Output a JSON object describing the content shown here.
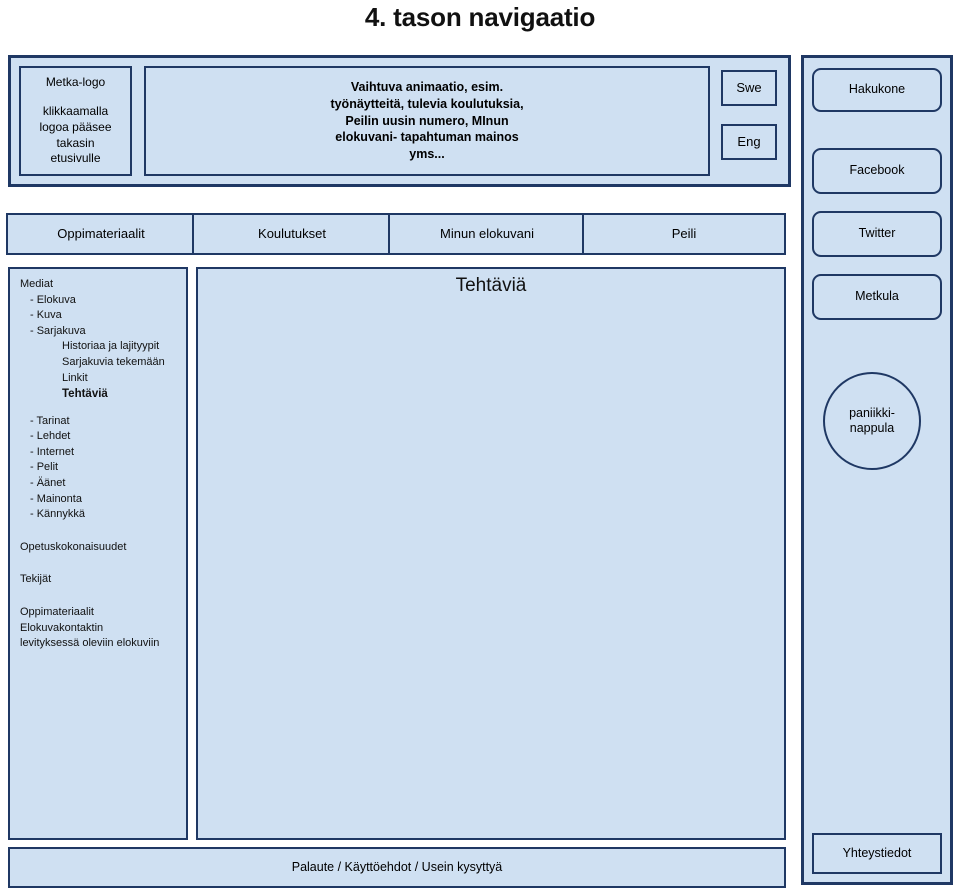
{
  "page": {
    "title": "4. tason navigaatio"
  },
  "colors": {
    "fill": "#cfe0f2",
    "border": "#1f3864",
    "text": "#111111",
    "background": "#ffffff"
  },
  "header": {
    "logo": {
      "title": "Metka-logo",
      "subtitle": "klikkaamalla\nlogoa pääsee\ntakasin\netusivulle",
      "subtitle_lines": [
        "klikkaamalla",
        "logoa pääsee",
        "takasin",
        "etusivulle"
      ]
    },
    "animation": {
      "lines": [
        "Vaihtuva animaatio, esim.",
        "työnäytteitä, tulevia koulutuksia,",
        "Peilin uusin numero, MInun",
        "elokuvani- tapahtuman mainos",
        "yms..."
      ]
    },
    "languages": [
      {
        "label": "Swe"
      },
      {
        "label": "Eng"
      }
    ]
  },
  "nav": {
    "tabs": [
      {
        "label": "Oppimateriaalit"
      },
      {
        "label": "Koulutukset"
      },
      {
        "label": "Minun elokuvani"
      },
      {
        "label": "Peili"
      }
    ]
  },
  "side_menu": {
    "items": [
      {
        "label": "Mediat",
        "level": 1
      },
      {
        "label": "- Elokuva",
        "level": 2
      },
      {
        "label": "- Kuva",
        "level": 2
      },
      {
        "label": "- Sarjakuva",
        "level": 2
      },
      {
        "label": "Historiaa ja lajityypit",
        "level": 3
      },
      {
        "label": "Sarjakuvia tekemään",
        "level": 3
      },
      {
        "label": "Linkit",
        "level": 3
      },
      {
        "label": "Tehtäviä",
        "level": 3,
        "active": true
      },
      {
        "label": "- Tarinat",
        "level": 2
      },
      {
        "label": "- Lehdet",
        "level": 2
      },
      {
        "label": "- Internet",
        "level": 2
      },
      {
        "label": "- Pelit",
        "level": 2
      },
      {
        "label": "- Äänet",
        "level": 2
      },
      {
        "label": "- Mainonta",
        "level": 2
      },
      {
        "label": "- Kännykkä",
        "level": 2
      },
      {
        "label": "Opetuskokonaisuudet",
        "level": 1
      },
      {
        "label": "Tekijät",
        "level": 1
      },
      {
        "label": "Oppimateriaalit",
        "level": 1
      },
      {
        "label": "Elokuvakontaktin",
        "level": 1
      },
      {
        "label": "levityksessä oleviin elokuviin",
        "level": 1
      }
    ]
  },
  "main": {
    "heading": "Tehtäviä"
  },
  "right_rail": {
    "buttons": [
      {
        "label": "Hakukone"
      },
      {
        "label": "Facebook"
      },
      {
        "label": "Twitter"
      },
      {
        "label": "Metkula"
      }
    ],
    "panic_button": {
      "line1": "paniikki-",
      "line2": "nappula"
    },
    "contact": {
      "label": "Yhteystiedot"
    }
  },
  "footer": {
    "links_label": "Palaute / Käyttöehdot / Usein kysyttyä"
  }
}
